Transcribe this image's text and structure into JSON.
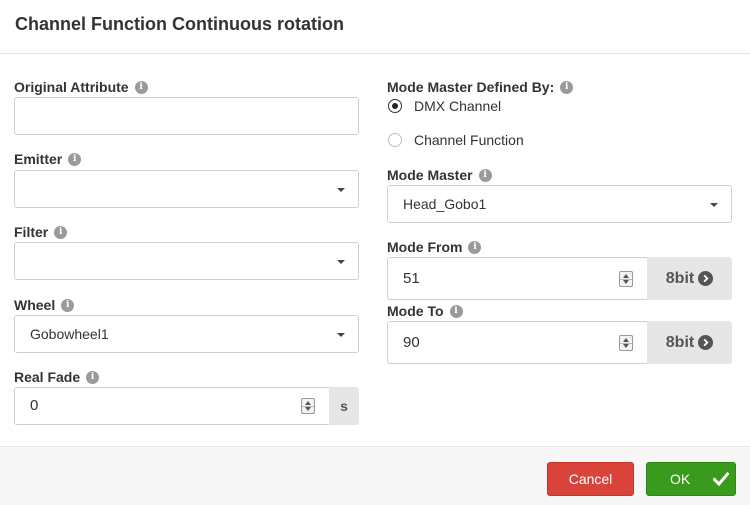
{
  "dialog": {
    "title": "Channel Function Continuous rotation",
    "info_glyph": "i"
  },
  "left": {
    "original_attribute": {
      "label": "Original Attribute",
      "value": ""
    },
    "emitter": {
      "label": "Emitter",
      "value": ""
    },
    "filter": {
      "label": "Filter",
      "value": ""
    },
    "wheel": {
      "label": "Wheel",
      "value": "Gobowheel1"
    },
    "real_fade": {
      "label": "Real Fade",
      "value": "0",
      "unit": "s"
    }
  },
  "right": {
    "mode_master_defined_by": {
      "label": "Mode Master Defined By:",
      "options": [
        {
          "label": "DMX Channel",
          "selected": true
        },
        {
          "label": "Channel Function",
          "selected": false
        }
      ]
    },
    "mode_master": {
      "label": "Mode Master",
      "value": "Head_Gobo1"
    },
    "mode_from": {
      "label": "Mode From",
      "value": "51",
      "resolution": "8bit"
    },
    "mode_to": {
      "label": "Mode To",
      "value": "90",
      "resolution": "8bit"
    }
  },
  "footer": {
    "cancel_label": "Cancel",
    "ok_label": "OK"
  },
  "colors": {
    "cancel": "#d9433a",
    "ok": "#3a9a1b",
    "addon_bg": "#e6e6e6"
  },
  "icons": [
    "info-icon",
    "chevron-down-icon",
    "chevron-right-circle-icon",
    "check-icon",
    "spinner-icon"
  ]
}
